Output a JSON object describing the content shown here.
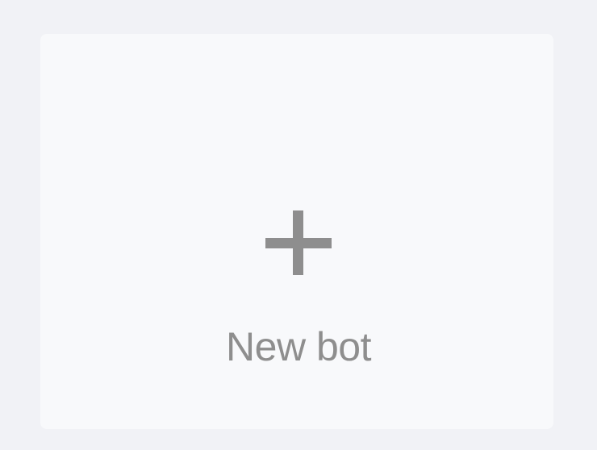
{
  "new_bot_card": {
    "label": "New bot",
    "icon": "plus-icon",
    "text_color": "#8e8e8e",
    "card_background": "#f8f9fb",
    "page_background": "#f1f2f6"
  }
}
